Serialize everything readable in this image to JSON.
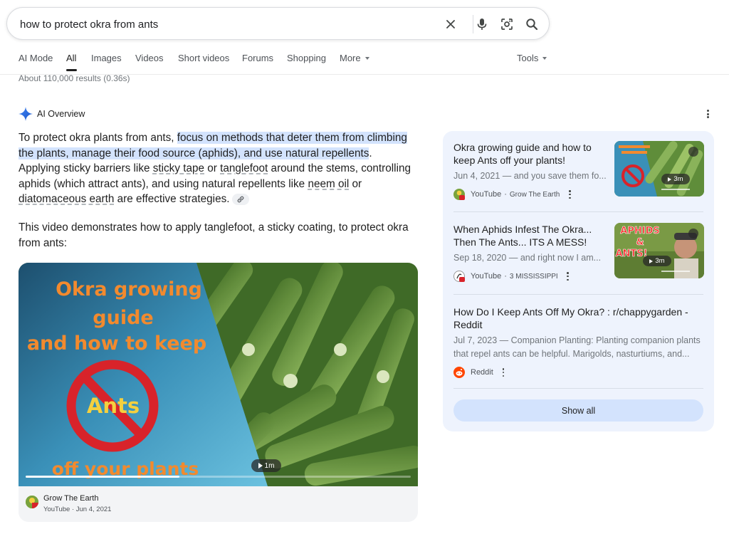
{
  "search": {
    "query": "how to protect okra from ants",
    "clear_icon": "close-icon",
    "voice_icon": "mic-icon",
    "lens_icon": "camera-lens-icon",
    "search_icon": "search-icon"
  },
  "tabs": {
    "items": [
      "AI Mode",
      "All",
      "Images",
      "Videos",
      "Short videos",
      "Forums",
      "Shopping",
      "More"
    ],
    "active": "All",
    "tools_label": "Tools"
  },
  "result_stats": "About 110,000 results (0.36s)",
  "ai_overview": {
    "label": "AI Overview",
    "p1": {
      "s1": "To protect okra plants from ants, ",
      "s2": "focus on methods that deter them from climbing the plants, manage their food source (aphids), and use natural repellents",
      "s3": ". Applying sticky barriers like ",
      "s4": "sticky tape",
      "s5": " or ",
      "s6": "tanglefoot",
      "s7": " around the stems, controlling aphids (which attract ants), and using natural repellents like ",
      "s8": "neem oil",
      "s9": " or ",
      "s10": "diatomaceous earth",
      "s11": " are effective strategies."
    },
    "video_intro": "This video demonstrates how to apply tanglefoot, a sticky coating, to protect okra from ants:",
    "video": {
      "thumb_text": [
        "Okra growing",
        "guide",
        "and how to keep",
        "Ants",
        "off your plants"
      ],
      "duration": "1m",
      "progress": 0.4,
      "channel": "Grow The Earth",
      "meta": "YouTube · Jun 4, 2021"
    }
  },
  "sources": [
    {
      "title": "Okra growing guide and how to keep Ants off your plants!",
      "snippet": "Jun 4, 2021 — and you save them fo...",
      "site": "YouTube",
      "author": "Grow The Earth",
      "duration": "3m"
    },
    {
      "title": "When Aphids Infest The Okra... Then The Ants... ITS A MESS!",
      "snippet": "Sep 18, 2020 — and right now I am...",
      "site": "YouTube",
      "author": "3 MISSISSIPPI",
      "duration": "3m",
      "thumb_text": [
        "APHIDS",
        "&",
        "ANTS!"
      ]
    },
    {
      "title": "How Do I Keep Ants Off My Okra? : r/chappygarden - Reddit",
      "snippet": "Jul 7, 2023 — Companion Planting: Planting companion plants that repel ants can be helpful. Marigolds, nasturtiums, and...",
      "site": "Reddit"
    }
  ],
  "show_all_label": "Show all",
  "colors": {
    "accent": "#0b57d0",
    "highlight": "#d3e3fd",
    "panel_bg": "#eef3fd",
    "thumb_text_orange": "#f28a2e",
    "thumb_text_yellow": "#f4d03f",
    "no_sign_red": "#d8232a"
  }
}
